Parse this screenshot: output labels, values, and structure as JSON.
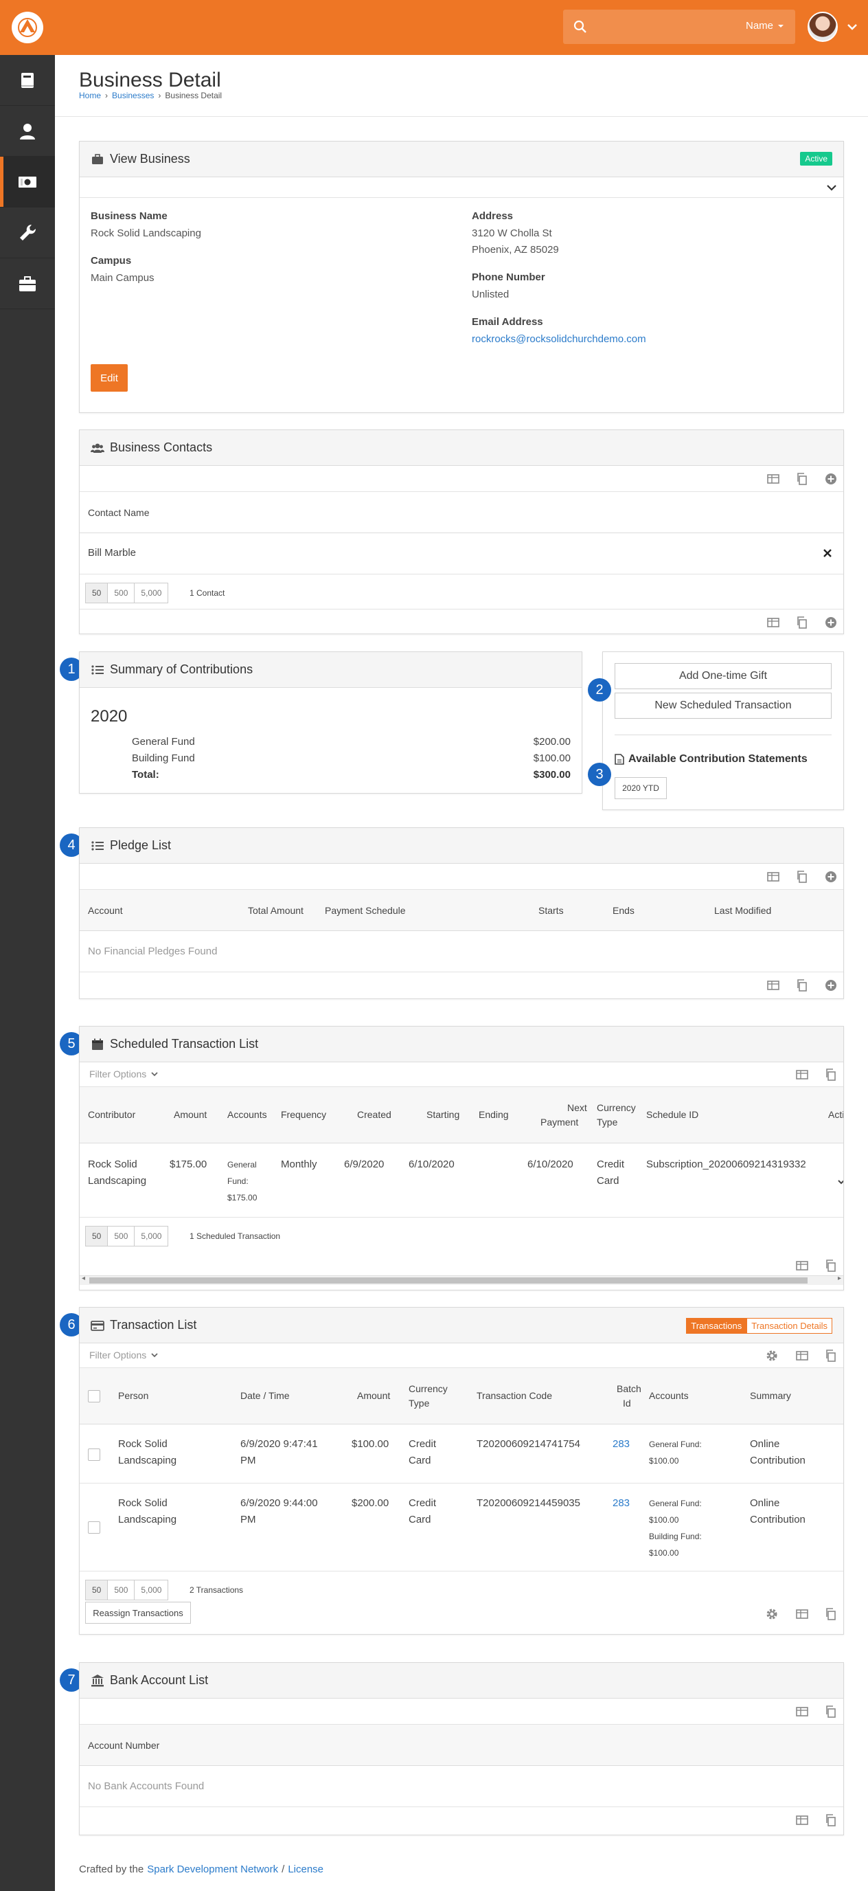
{
  "header": {
    "search_placeholder": "",
    "search_scope": "Name"
  },
  "page": {
    "title": "Business Detail",
    "breadcrumbs": [
      "Home",
      "Businesses",
      "Business Detail"
    ]
  },
  "view_business": {
    "title": "View Business",
    "status": "Active",
    "business_name_label": "Business Name",
    "business_name": "Rock Solid Landscaping",
    "campus_label": "Campus",
    "campus": "Main Campus",
    "address_label": "Address",
    "address_line1": "3120 W Cholla St",
    "address_line2": "Phoenix, AZ 85029",
    "phone_label": "Phone Number",
    "phone": "Unlisted",
    "email_label": "Email Address",
    "email": "rockrocks@rocksolidchurchdemo.com",
    "edit_label": "Edit"
  },
  "contacts": {
    "title": "Business Contacts",
    "column": "Contact Name",
    "rows": [
      "Bill Marble"
    ],
    "pager": [
      "50",
      "500",
      "5,000"
    ],
    "count": "1 Contact"
  },
  "summary": {
    "step": "1",
    "title": "Summary of Contributions",
    "year": "2020",
    "funds": [
      {
        "name": "General Fund",
        "amount": "$200.00"
      },
      {
        "name": "Building Fund",
        "amount": "$100.00"
      }
    ],
    "total_label": "Total:",
    "total": "$300.00"
  },
  "actions": {
    "step2": "2",
    "add_gift": "Add One-time Gift",
    "new_scheduled": "New Scheduled Transaction",
    "step3": "3",
    "statements_title": "Available Contribution Statements",
    "statement_ytd": "2020 YTD"
  },
  "pledges": {
    "step": "4",
    "title": "Pledge List",
    "columns": [
      "Account",
      "Total Amount",
      "Payment Schedule",
      "Starts",
      "Ends",
      "Last Modified"
    ],
    "empty": "No Financial Pledges Found"
  },
  "scheduled": {
    "step": "5",
    "title": "Scheduled Transaction List",
    "filter": "Filter Options",
    "columns": [
      "Contributor",
      "Amount",
      "Accounts",
      "Frequency",
      "Created",
      "Starting",
      "Ending",
      "Next",
      "Payment",
      "Currency",
      "Type",
      "Schedule ID",
      "Acti"
    ],
    "row": {
      "contributor1": "Rock Solid",
      "contributor2": "Landscaping",
      "amount": "$175.00",
      "accounts1": "General",
      "accounts2": "Fund:",
      "accounts3": "$175.00",
      "frequency": "Monthly",
      "created": "6/9/2020",
      "starting": "6/10/2020",
      "next_payment": "6/10/2020",
      "currency1": "Credit",
      "currency2": "Card",
      "schedule_id": "Subscription_20200609214319332"
    },
    "pager": [
      "50",
      "500",
      "5,000"
    ],
    "count": "1 Scheduled Transaction"
  },
  "transactions": {
    "step": "6",
    "title": "Transaction List",
    "toggle": [
      "Transactions",
      "Transaction Details"
    ],
    "filter": "Filter Options",
    "columns": [
      "Person",
      "Date / Time",
      "Amount",
      "Currency",
      "Type",
      "Transaction Code",
      "Batch",
      "Id",
      "Accounts",
      "Summary"
    ],
    "rows": [
      {
        "person1": "Rock Solid",
        "person2": "Landscaping",
        "date1": "6/9/2020 9:47:41",
        "date2": "PM",
        "amount": "$100.00",
        "cur1": "Credit",
        "cur2": "Card",
        "code": "T20200609214741754",
        "batch": "283",
        "acc1": "General Fund:",
        "acc2": "$100.00",
        "acc3": "",
        "acc4": "",
        "sum1": "Online",
        "sum2": "Contribution"
      },
      {
        "person1": "Rock Solid",
        "person2": "Landscaping",
        "date1": "6/9/2020 9:44:00",
        "date2": "PM",
        "amount": "$200.00",
        "cur1": "Credit",
        "cur2": "Card",
        "code": "T20200609214459035",
        "batch": "283",
        "acc1": "General Fund:",
        "acc2": "$100.00",
        "acc3": "Building Fund:",
        "acc4": "$100.00",
        "sum1": "Online",
        "sum2": "Contribution"
      }
    ],
    "pager": [
      "50",
      "500",
      "5,000"
    ],
    "count": "2 Transactions",
    "reassign": "Reassign Transactions"
  },
  "bank": {
    "step": "7",
    "title": "Bank Account List",
    "column": "Account Number",
    "empty": "No Bank Accounts Found"
  },
  "footer": {
    "prefix": "Crafted by the",
    "network": "Spark Development Network",
    "sep": "/",
    "license": "License"
  },
  "colors": {
    "brand": "#ee7625",
    "sidebar": "#343434",
    "link": "#2b7bca",
    "step": "#1a66c2",
    "active_badge": "#16c98d"
  }
}
